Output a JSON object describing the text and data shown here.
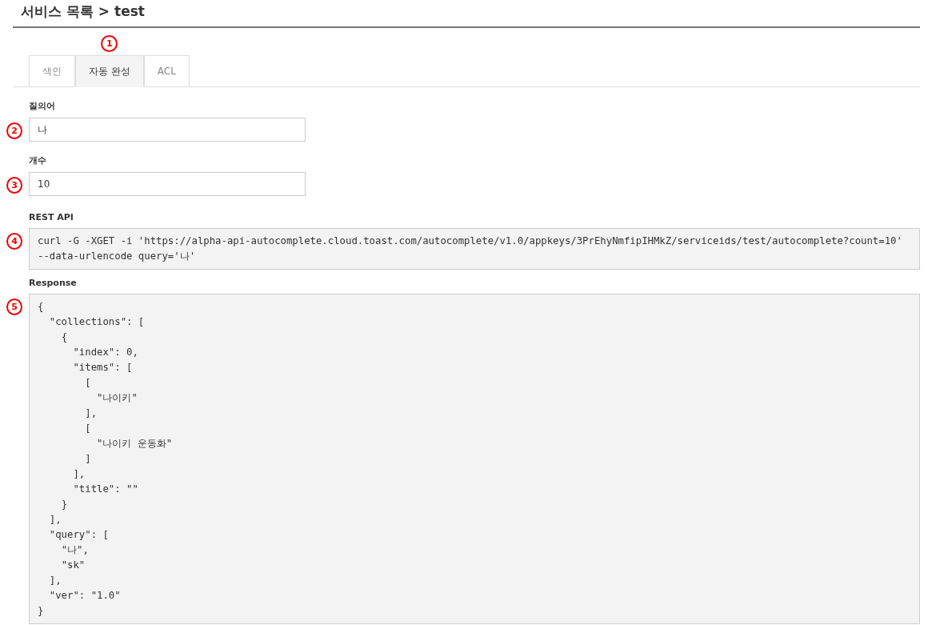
{
  "title": "서비스 목록 > test",
  "tabs": [
    {
      "label": "색인",
      "selected": false
    },
    {
      "label": "자동 완성",
      "selected": true,
      "callout": "1"
    },
    {
      "label": "ACL",
      "selected": false
    }
  ],
  "fields": [
    {
      "label": "질의어",
      "value": "나",
      "callout": "2"
    },
    {
      "label": "개수",
      "value": "10",
      "callout": "3"
    }
  ],
  "rest_api": {
    "label": "REST API",
    "callout": "4",
    "code": "curl -G -XGET -i 'https://alpha-api-autocomplete.cloud.toast.com/autocomplete/v1.0/appkeys/3PrEhyNmfipIHMkZ/serviceids/test/autocomplete?count=10' --data-urlencode query='나'"
  },
  "response": {
    "label": "Response",
    "callout": "5",
    "code": "{\n  \"collections\": [\n    {\n      \"index\": 0,\n      \"items\": [\n        [\n          \"나이키\"\n        ],\n        [\n          \"나이키 운동화\"\n        ]\n      ],\n      \"title\": \"\"\n    }\n  ],\n  \"query\": [\n    \"나\",\n    \"sk\"\n  ],\n  \"ver\": \"1.0\"\n}"
  }
}
